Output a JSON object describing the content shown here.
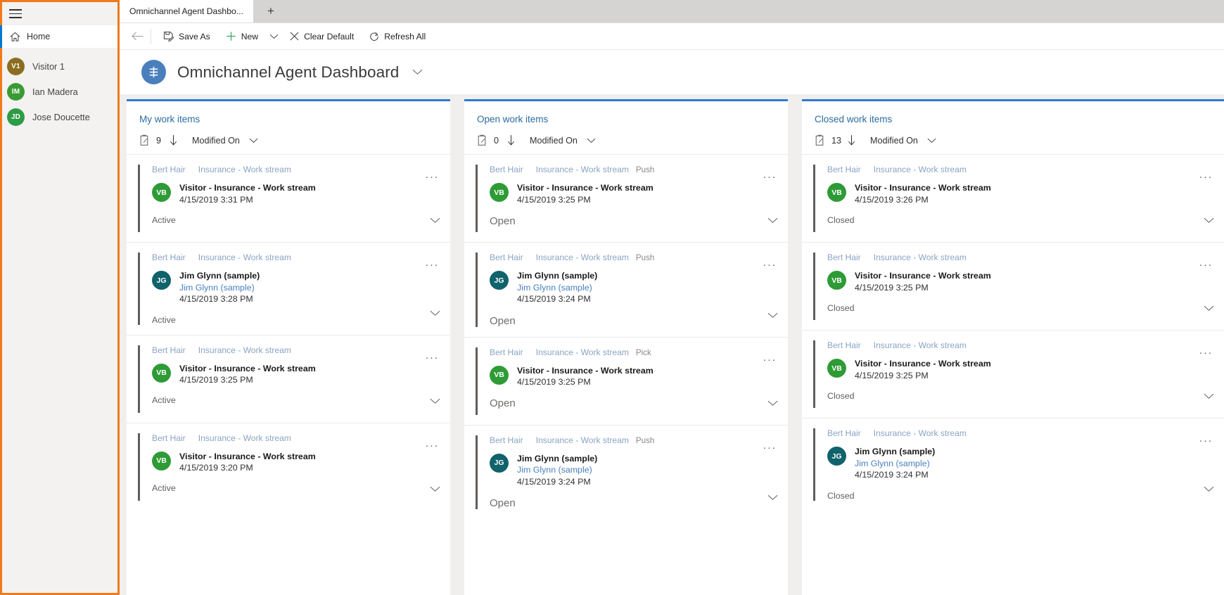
{
  "sidebar": {
    "menu_icon": "hamburger-icon",
    "home": {
      "label": "Home",
      "icon": "home-icon"
    },
    "users": [
      {
        "initials": "V1",
        "name": "Visitor 1",
        "color": "#8a6d1f"
      },
      {
        "initials": "IM",
        "name": "Ian Madera",
        "color": "#3a9b35"
      },
      {
        "initials": "JD",
        "name": "Jose Doucette",
        "color": "#2e9b46"
      }
    ]
  },
  "tabstrip": {
    "tab_label": "Omnichannel Agent Dashbo...",
    "new_tab_label": "+"
  },
  "commandbar": {
    "back_label": "Back",
    "save_as": "Save As",
    "new": "New",
    "clear_default": "Clear Default",
    "refresh_all": "Refresh All"
  },
  "page": {
    "title": "Omnichannel Agent Dashboard",
    "icon": "dashboard-icon"
  },
  "columns": [
    {
      "title": "My work items",
      "count": "9",
      "sort_field": "Modified On",
      "cards": [
        {
          "owner": "Bert Hair",
          "stream": "Insurance - Work stream",
          "mode": "",
          "initials": "VB",
          "avatar_color": "#2e9b36",
          "title": "Visitor - Insurance - Work stream",
          "subtitle": "",
          "date": "4/15/2019 3:31 PM",
          "status": "Active"
        },
        {
          "owner": "Bert Hair",
          "stream": "Insurance - Work stream",
          "mode": "",
          "initials": "JG",
          "avatar_color": "#10626b",
          "title": "Jim Glynn (sample)",
          "subtitle": "Jim Glynn (sample)",
          "date": "4/15/2019 3:28 PM",
          "status": "Active"
        },
        {
          "owner": "Bert Hair",
          "stream": "Insurance - Work stream",
          "mode": "",
          "initials": "VB",
          "avatar_color": "#2e9b36",
          "title": "Visitor - Insurance - Work stream",
          "subtitle": "",
          "date": "4/15/2019 3:25 PM",
          "status": "Active"
        },
        {
          "owner": "Bert Hair",
          "stream": "Insurance - Work stream",
          "mode": "",
          "initials": "VB",
          "avatar_color": "#2e9b36",
          "title": "Visitor - Insurance - Work stream",
          "subtitle": "",
          "date": "4/15/2019 3:20 PM",
          "status": "Active"
        }
      ]
    },
    {
      "title": "Open work items",
      "count": "0",
      "sort_field": "Modified On",
      "cards": [
        {
          "owner": "Bert Hair",
          "stream": "Insurance - Work stream",
          "mode": "Push",
          "initials": "VB",
          "avatar_color": "#2e9b36",
          "title": "Visitor - Insurance - Work stream",
          "subtitle": "",
          "date": "4/15/2019 3:25 PM",
          "status": "Open"
        },
        {
          "owner": "Bert Hair",
          "stream": "Insurance - Work stream",
          "mode": "Push",
          "initials": "JG",
          "avatar_color": "#10626b",
          "title": "Jim Glynn (sample)",
          "subtitle": "Jim Glynn (sample)",
          "date": "4/15/2019 3:24 PM",
          "status": "Open"
        },
        {
          "owner": "Bert Hair",
          "stream": "Insurance - Work stream",
          "mode": "Pick",
          "initials": "VB",
          "avatar_color": "#2e9b36",
          "title": "Visitor - Insurance - Work stream",
          "subtitle": "",
          "date": "4/15/2019 3:25 PM",
          "status": "Open"
        },
        {
          "owner": "Bert Hair",
          "stream": "Insurance - Work stream",
          "mode": "Push",
          "initials": "JG",
          "avatar_color": "#10626b",
          "title": "Jim Glynn (sample)",
          "subtitle": "Jim Glynn (sample)",
          "date": "4/15/2019 3:24 PM",
          "status": "Open"
        }
      ]
    },
    {
      "title": "Closed work items",
      "count": "13",
      "sort_field": "Modified On",
      "cards": [
        {
          "owner": "Bert Hair",
          "stream": "Insurance - Work stream",
          "mode": "",
          "initials": "VB",
          "avatar_color": "#2e9b36",
          "title": "Visitor - Insurance - Work stream",
          "subtitle": "",
          "date": "4/15/2019 3:26 PM",
          "status": "Closed"
        },
        {
          "owner": "Bert Hair",
          "stream": "Insurance - Work stream",
          "mode": "",
          "initials": "VB",
          "avatar_color": "#2e9b36",
          "title": "Visitor - Insurance - Work stream",
          "subtitle": "",
          "date": "4/15/2019 3:25 PM",
          "status": "Closed"
        },
        {
          "owner": "Bert Hair",
          "stream": "Insurance - Work stream",
          "mode": "",
          "initials": "VB",
          "avatar_color": "#2e9b36",
          "title": "Visitor - Insurance - Work stream",
          "subtitle": "",
          "date": "4/15/2019 3:25 PM",
          "status": "Closed"
        },
        {
          "owner": "Bert Hair",
          "stream": "Insurance - Work stream",
          "mode": "",
          "initials": "JG",
          "avatar_color": "#10626b",
          "title": "Jim Glynn (sample)",
          "subtitle": "Jim Glynn (sample)",
          "date": "4/15/2019 3:24 PM",
          "status": "Closed"
        }
      ]
    }
  ],
  "icons": {
    "ellipsis": "···"
  },
  "colors": {
    "accent": "#2b7cd3",
    "highlight_border": "#f07a1a",
    "link": "#2b6ca3",
    "new_plus": "#38a169"
  }
}
